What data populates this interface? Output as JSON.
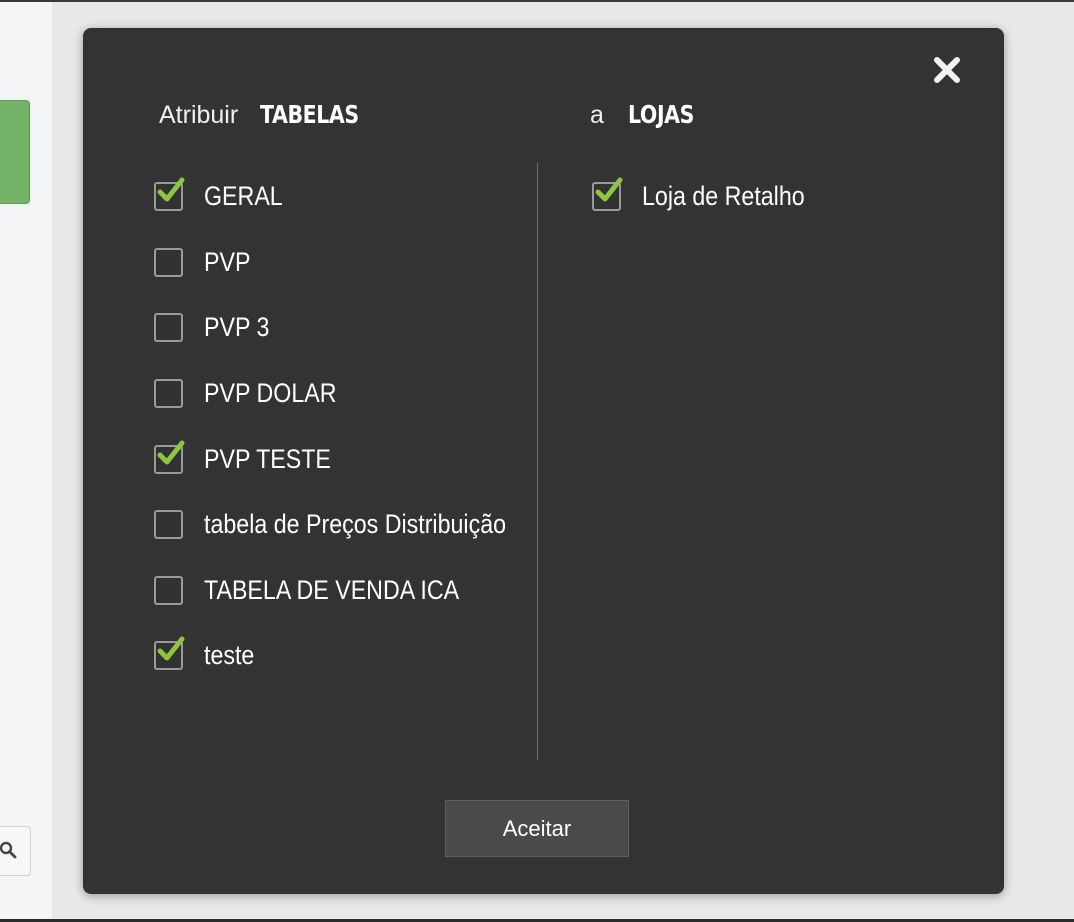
{
  "dialog": {
    "left_heading": {
      "prefix": "Atribuir",
      "emphasis": "TABELAS"
    },
    "right_heading": {
      "prefix": "a",
      "emphasis": "LOJAS"
    },
    "close_icon": "close-icon",
    "check_color": "#8ec63f",
    "tables": [
      {
        "label": "GERAL",
        "checked": true
      },
      {
        "label": "PVP",
        "checked": false
      },
      {
        "label": "PVP 3",
        "checked": false
      },
      {
        "label": "PVP DOLAR",
        "checked": false
      },
      {
        "label": "PVP TESTE",
        "checked": true
      },
      {
        "label": "tabela de Preços Distribuição",
        "checked": false
      },
      {
        "label": "TABELA DE VENDA ICA",
        "checked": false
      },
      {
        "label": "teste",
        "checked": true
      }
    ],
    "stores": [
      {
        "label": "Loja de Retalho",
        "checked": true
      }
    ],
    "accept_label": "Aceitar"
  },
  "background": {
    "accent_color": "#74b267",
    "search_icon": "search-icon"
  }
}
